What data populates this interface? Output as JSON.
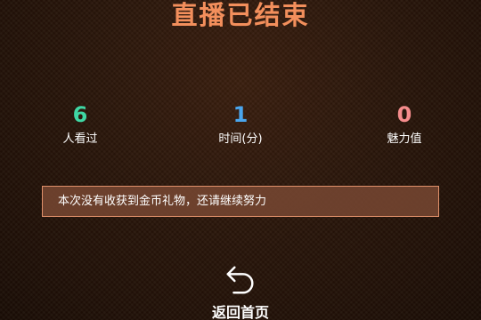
{
  "title": "直播已结束",
  "stats": [
    {
      "value": "6",
      "label": "人看过",
      "color": "#3fd7a4"
    },
    {
      "value": "1",
      "label": "时间(分)",
      "color": "#4aa6ee"
    },
    {
      "value": "0",
      "label": "魅力值",
      "color": "#f58c8c"
    }
  ],
  "notice": "本次没有收获到金币礼物，还请继续努力",
  "return_button": {
    "label": "返回首页",
    "icon": "return-arrow-icon"
  },
  "colors": {
    "title": "#f38f5c",
    "notice_border": "#e0906a"
  }
}
